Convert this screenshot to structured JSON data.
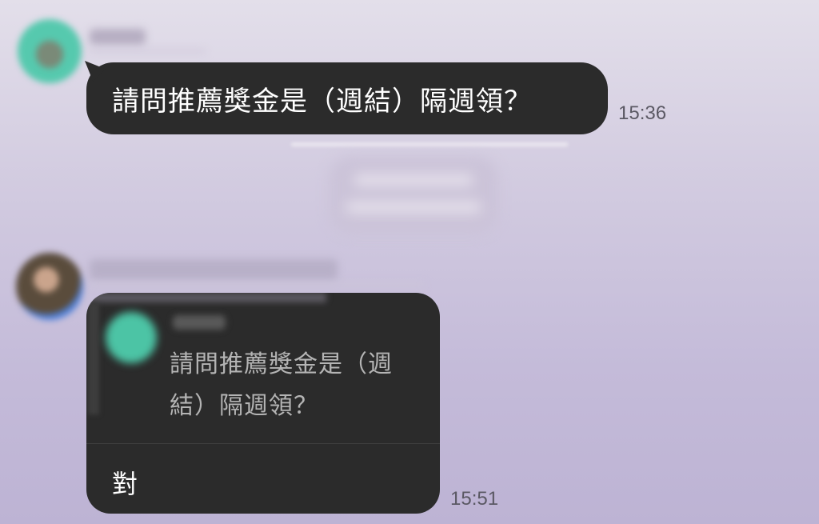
{
  "messages": [
    {
      "text": "請問推薦獎金是（週結）隔週領？",
      "time": "15:36"
    },
    {
      "quote": {
        "text_line1": "請問推薦獎金是（週",
        "text_line2": "結）隔週領？"
      },
      "text": "對",
      "time": "15:51"
    }
  ]
}
